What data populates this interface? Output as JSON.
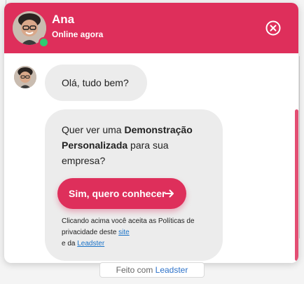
{
  "header": {
    "agent_name": "Ana",
    "status": "Online agora"
  },
  "messages": {
    "greeting": "Olá, tudo bem?",
    "question_prefix": "Quer ver uma ",
    "question_bold": "Demonstração Personalizada",
    "question_suffix": " para sua empresa?",
    "cta_label": "Sim, quero conhecer",
    "disclaimer_prefix": "Clicando acima você aceita as Políticas de privacidade deste ",
    "disclaimer_link_site": "site",
    "disclaimer_middle": " e da ",
    "disclaimer_link_leadster": "Leadster"
  },
  "footer": {
    "prefix": "Feito com ",
    "brand": "Leadster"
  },
  "colors": {
    "accent": "#de2f5b",
    "online": "#2ecc71",
    "link": "#1a73c8"
  }
}
